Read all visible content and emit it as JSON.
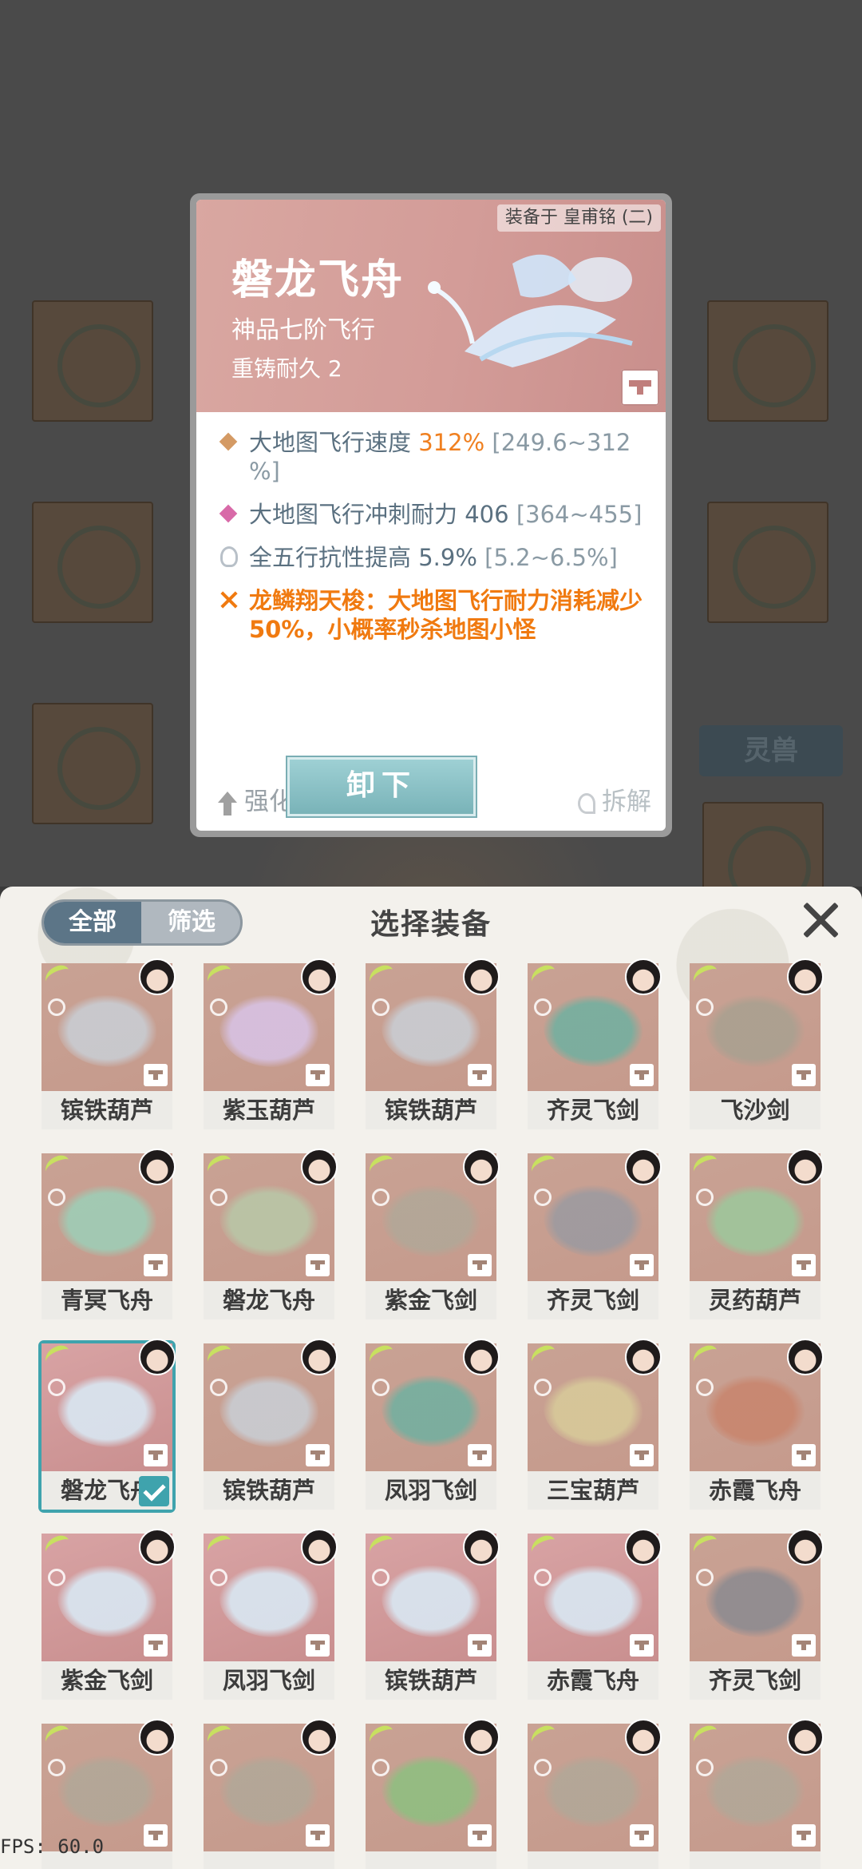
{
  "detail": {
    "equipped_on": "装备于 皇甫铭 (二)",
    "title": "磐龙飞舟",
    "grade": "神品七阶飞行",
    "durability": "重铸耐久 2",
    "stats": [
      {
        "label": "大地图飞行速度",
        "value": "312%",
        "range": "[249.6~312",
        "range2": "%]",
        "color": "#d49a64"
      },
      {
        "label": "大地图飞行冲刺耐力",
        "value": "406",
        "range": "[364~455]",
        "color": "#d86aa8"
      },
      {
        "label": "全五行抗性提高",
        "value": "5.9%",
        "range": "[5.2~6.5%]"
      }
    ],
    "special": "龙鳞翔天梭：大地图飞行耐力消耗减少50%，小概率秒杀地图小怪",
    "buttons": {
      "upgrade": "强化",
      "unequip": "卸下",
      "dismantle": "拆解"
    }
  },
  "background": {
    "tag": "灵兽"
  },
  "panel": {
    "title": "选择装备",
    "tabs": {
      "all": "全部",
      "filter": "筛选"
    }
  },
  "items": [
    {
      "name": "镔铁葫芦",
      "tone": "tan",
      "obj": "#c9cfd6"
    },
    {
      "name": "紫玉葫芦",
      "tone": "tan",
      "obj": "#d8c4e8"
    },
    {
      "name": "镔铁葫芦",
      "tone": "tan",
      "obj": "#c9cfd6"
    },
    {
      "name": "齐灵飞剑",
      "tone": "tan",
      "obj": "#6fb0a0"
    },
    {
      "name": "飞沙剑",
      "tone": "tan",
      "obj": "#a8a090"
    },
    {
      "name": "青冥飞舟",
      "tone": "tan",
      "obj": "#9cd0b8"
    },
    {
      "name": "磐龙飞舟",
      "tone": "tan",
      "obj": "#b8c8a8"
    },
    {
      "name": "紫金飞剑",
      "tone": "tan",
      "obj": "#b0a898"
    },
    {
      "name": "齐灵飞剑",
      "tone": "tan",
      "obj": "#9a9aa0"
    },
    {
      "name": "灵药葫芦",
      "tone": "tan",
      "obj": "#9cc89c"
    },
    {
      "name": "磐龙飞舟",
      "tone": "pink",
      "obj": "#d9ecf8",
      "selected": true
    },
    {
      "name": "镔铁葫芦",
      "tone": "tan",
      "obj": "#c9cfd6"
    },
    {
      "name": "凤羽飞剑",
      "tone": "tan",
      "obj": "#6fb0a0"
    },
    {
      "name": "三宝葫芦",
      "tone": "tan",
      "obj": "#d8cc9a"
    },
    {
      "name": "赤霞飞舟",
      "tone": "tan",
      "obj": "#c8846c"
    },
    {
      "name": "紫金飞剑",
      "tone": "pink",
      "obj": "#d9ecf8"
    },
    {
      "name": "凤羽飞剑",
      "tone": "pink",
      "obj": "#d9ecf8"
    },
    {
      "name": "镔铁葫芦",
      "tone": "pink",
      "obj": "#d9ecf8"
    },
    {
      "name": "赤霞飞舟",
      "tone": "pink",
      "obj": "#d9ecf8"
    },
    {
      "name": "齐灵飞剑",
      "tone": "tan",
      "obj": "#8a8a90"
    },
    {
      "name": "",
      "tone": "tan",
      "obj": "#b0a898"
    },
    {
      "name": "",
      "tone": "tan",
      "obj": "#b0a898"
    },
    {
      "name": "",
      "tone": "tan",
      "obj": "#8cc080"
    },
    {
      "name": "",
      "tone": "tan",
      "obj": "#b0a898"
    },
    {
      "name": "",
      "tone": "tan",
      "obj": "#b0a898"
    }
  ],
  "fps": "FPS: 60.0"
}
